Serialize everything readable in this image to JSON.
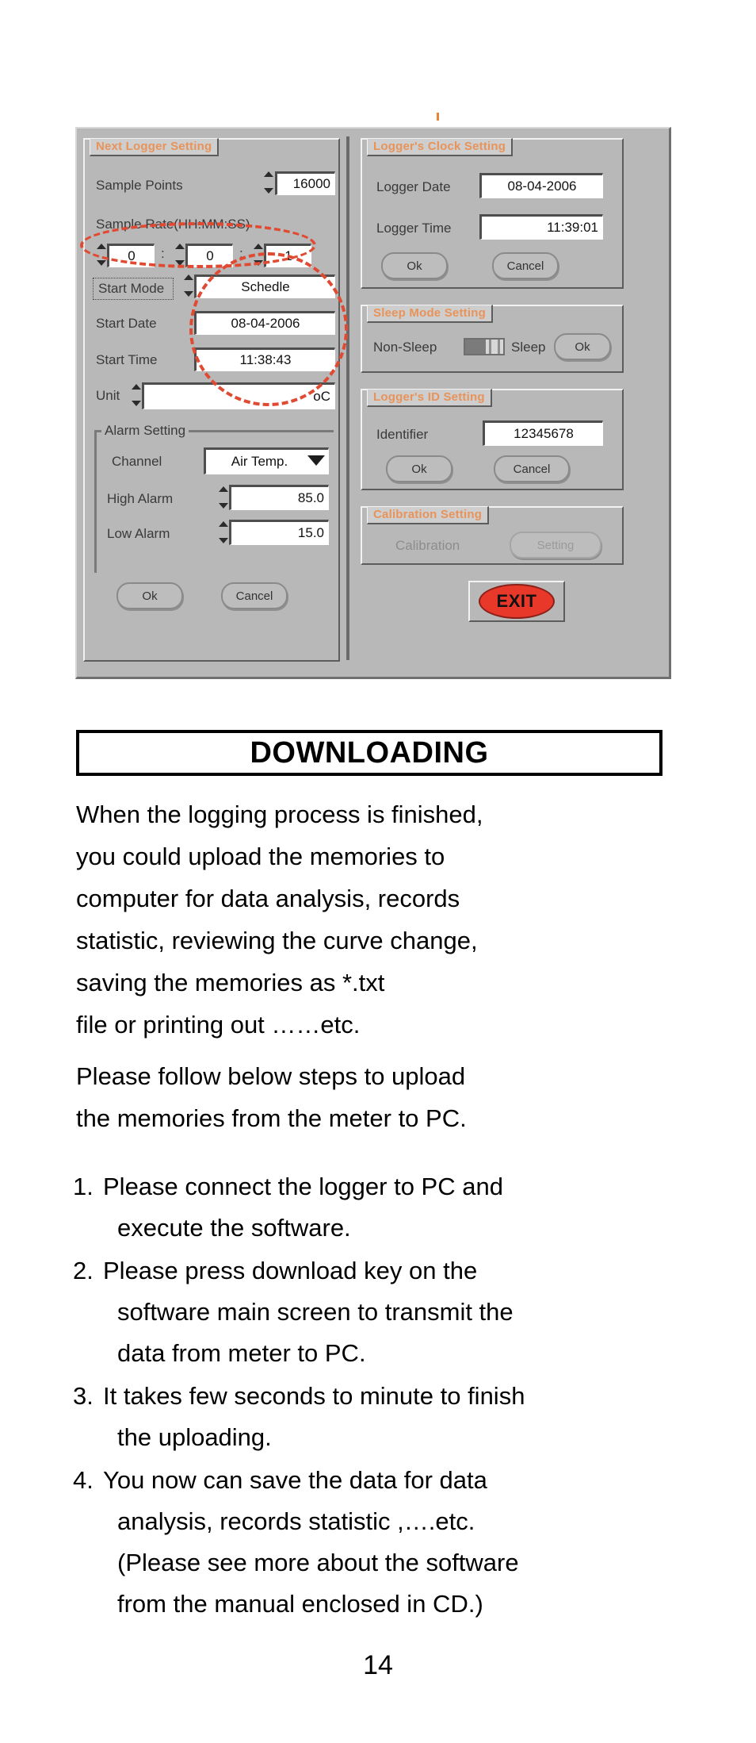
{
  "dialog": {
    "next_logger": {
      "title": "Next Logger Setting",
      "sample_points_label": "Sample Points",
      "sample_points_value": "16000",
      "sample_rate_label": "Sample Rate(HH:MM:SS)",
      "rate_hh": "0",
      "rate_mm": "0",
      "rate_ss": "1",
      "colon": ":",
      "start_mode_label": "Start Mode",
      "start_mode_value": "Schedle",
      "start_date_label": "Start Date",
      "start_date_value": "08-04-2006",
      "start_time_label": "Start Time",
      "start_time_value": "11:38:43",
      "unit_label": "Unit",
      "unit_value": "oC",
      "alarm": {
        "caption": "Alarm  Setting",
        "channel_label": "Channel",
        "channel_value": "Air Temp.",
        "high_alarm_label": "High Alarm",
        "high_alarm_value": "85.0",
        "low_alarm_label": "Low Alarm",
        "low_alarm_value": "15.0"
      },
      "ok_label": "Ok",
      "cancel_label": "Cancel"
    },
    "clock": {
      "title": "Logger's Clock Setting",
      "date_label": "Logger Date",
      "date_value": "08-04-2006",
      "time_label": "Logger Time",
      "time_value": "11:39:01",
      "ok_label": "Ok",
      "cancel_label": "Cancel"
    },
    "sleep": {
      "title": "Sleep Mode Setting",
      "off_label": "Non-Sleep",
      "on_label": "Sleep",
      "ok_label": "Ok"
    },
    "id": {
      "title": "Logger's ID Setting",
      "identifier_label": "Identifier",
      "identifier_value": "12345678",
      "ok_label": "Ok",
      "cancel_label": "Cancel"
    },
    "calibration": {
      "title": "Calibration Setting",
      "calibration_label": "Calibration",
      "setting_label": "Setting"
    },
    "exit_label": "EXIT",
    "accent_color": "#e8935a",
    "exit_color": "#e8382a",
    "annotation_color": "#e04a32"
  },
  "page": {
    "heading": "DOWNLOADING",
    "paragraph1": [
      "When the logging process is finished,",
      "you could upload the memories to",
      "computer for data analysis, records",
      "statistic, reviewing the curve change,",
      "saving the memories as *.txt",
      "file or printing out ……etc."
    ],
    "paragraph2": [
      "Please follow  below steps to upload",
      "the memories from the meter to PC."
    ],
    "steps": [
      {
        "number": "1.",
        "lines": [
          "Please connect the logger to PC and",
          "execute the software."
        ]
      },
      {
        "number": "2.",
        "lines": [
          "Please press download key on the",
          "software main screen to transmit the",
          "data from meter to PC."
        ]
      },
      {
        "number": "3.",
        "lines": [
          "It takes few seconds to minute to finish",
          "the uploading."
        ]
      },
      {
        "number": "4.",
        "lines": [
          "You now can save the data for data",
          "analysis, records statistic ,….etc.",
          "(Please see more about the software",
          "from the manual enclosed in CD.)"
        ]
      }
    ],
    "page_number": "14"
  }
}
